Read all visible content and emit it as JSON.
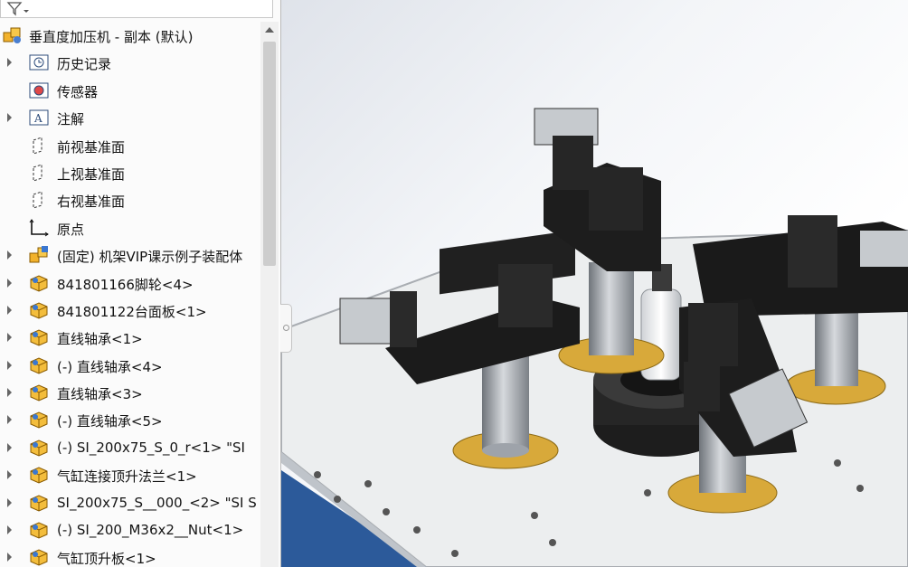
{
  "tree": {
    "root": {
      "label": "垂直度加压机 - 副本  (默认)",
      "icon": "assembly-icon"
    },
    "items": [
      {
        "label": "历史记录",
        "icon": "history-icon",
        "expandable": true
      },
      {
        "label": "传感器",
        "icon": "sensor-icon",
        "expandable": false
      },
      {
        "label": "注解",
        "icon": "annotation-icon",
        "expandable": true
      },
      {
        "label": "前视基准面",
        "icon": "plane-icon",
        "expandable": false
      },
      {
        "label": "上视基准面",
        "icon": "plane-icon",
        "expandable": false
      },
      {
        "label": "右视基准面",
        "icon": "plane-icon",
        "expandable": false
      },
      {
        "label": "原点",
        "icon": "origin-icon",
        "expandable": false
      },
      {
        "label": "(固定) 机架VIP课示例子装配体",
        "icon": "subassembly-icon",
        "expandable": true
      },
      {
        "label": "841801166脚轮<4>",
        "icon": "part-icon",
        "expandable": true
      },
      {
        "label": "841801122台面板<1>",
        "icon": "part-icon",
        "expandable": true
      },
      {
        "label": "直线轴承<1>",
        "icon": "part-icon",
        "expandable": true
      },
      {
        "label": "(-) 直线轴承<4>",
        "icon": "part-icon",
        "expandable": true
      },
      {
        "label": "直线轴承<3>",
        "icon": "part-icon",
        "expandable": true
      },
      {
        "label": "(-) 直线轴承<5>",
        "icon": "part-icon",
        "expandable": true
      },
      {
        "label": "(-) SI_200x75_S_0_r<1>  \"SI",
        "icon": "part-icon",
        "expandable": true
      },
      {
        "label": "气缸连接顶升法兰<1>",
        "icon": "part-icon",
        "expandable": true
      },
      {
        "label": "SI_200x75_S__000_<2>  \"SI S",
        "icon": "part-icon",
        "expandable": true
      },
      {
        "label": "(-) SI_200_M36x2__Nut<1>",
        "icon": "part-icon",
        "expandable": true
      },
      {
        "label": "气缸顶升板<1>",
        "icon": "part-icon",
        "expandable": true
      }
    ]
  },
  "taskpane": [
    "solidworks-resources-icon",
    "design-library-icon",
    "file-explorer-icon",
    "appearances-icon",
    "custom-properties-icon",
    "forum-icon"
  ],
  "colors": {
    "accent": "#1f5fa8",
    "bracket": "#1b1b1b",
    "brass": "#d8a93a",
    "steel": "#9ea3aa"
  }
}
